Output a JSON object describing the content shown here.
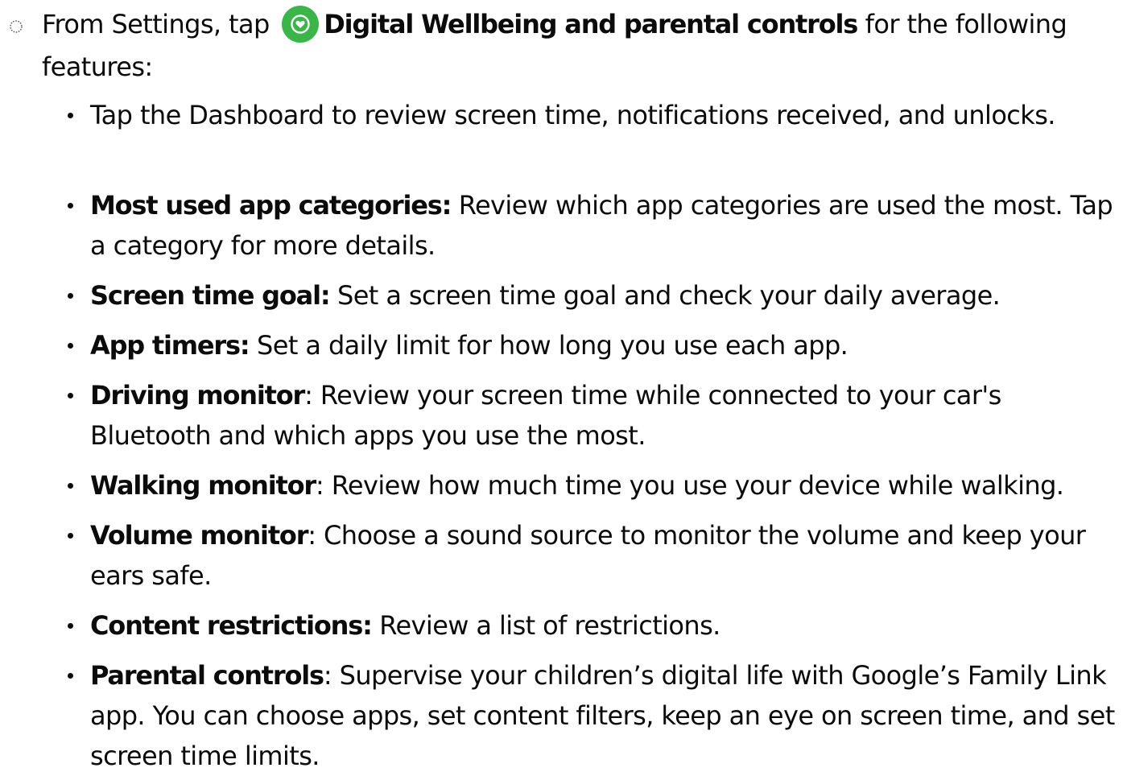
{
  "intro": {
    "prefix": "From Settings, tap ",
    "app_name": "Digital Wellbeing and parental controls",
    "suffix": " for the following features:",
    "icon": "digital-wellbeing-heart-icon",
    "icon_color": "#3bb54a"
  },
  "features": [
    {
      "label": "",
      "text": "Tap the Dashboard to review screen time, notifications received, and unlocks."
    },
    {
      "label": "Most used app categories:",
      "text": " Review which app categories are used the most. Tap a category for more details."
    },
    {
      "label": "Screen time goal:",
      "text": " Set a screen time goal and check your daily average."
    },
    {
      "label": "App timers:",
      "text": " Set a daily limit for how long you use each app."
    },
    {
      "label": "Driving monitor",
      "text": ": Review your screen time while connected to your car's Bluetooth and which apps you use the most."
    },
    {
      "label": "Walking monitor",
      "text": ": Review how much time you use your device while walking."
    },
    {
      "label": "Volume monitor",
      "text": ": Choose a sound source to monitor the volume and keep your ears safe."
    },
    {
      "label": "Content restrictions:",
      "text": " Review a list of restrictions."
    },
    {
      "label": "Parental controls",
      "text": ": Supervise your children’s digital life with Google’s Family Link app. You can choose apps, set content filters, keep an eye on screen time, and set screen time limits."
    }
  ]
}
